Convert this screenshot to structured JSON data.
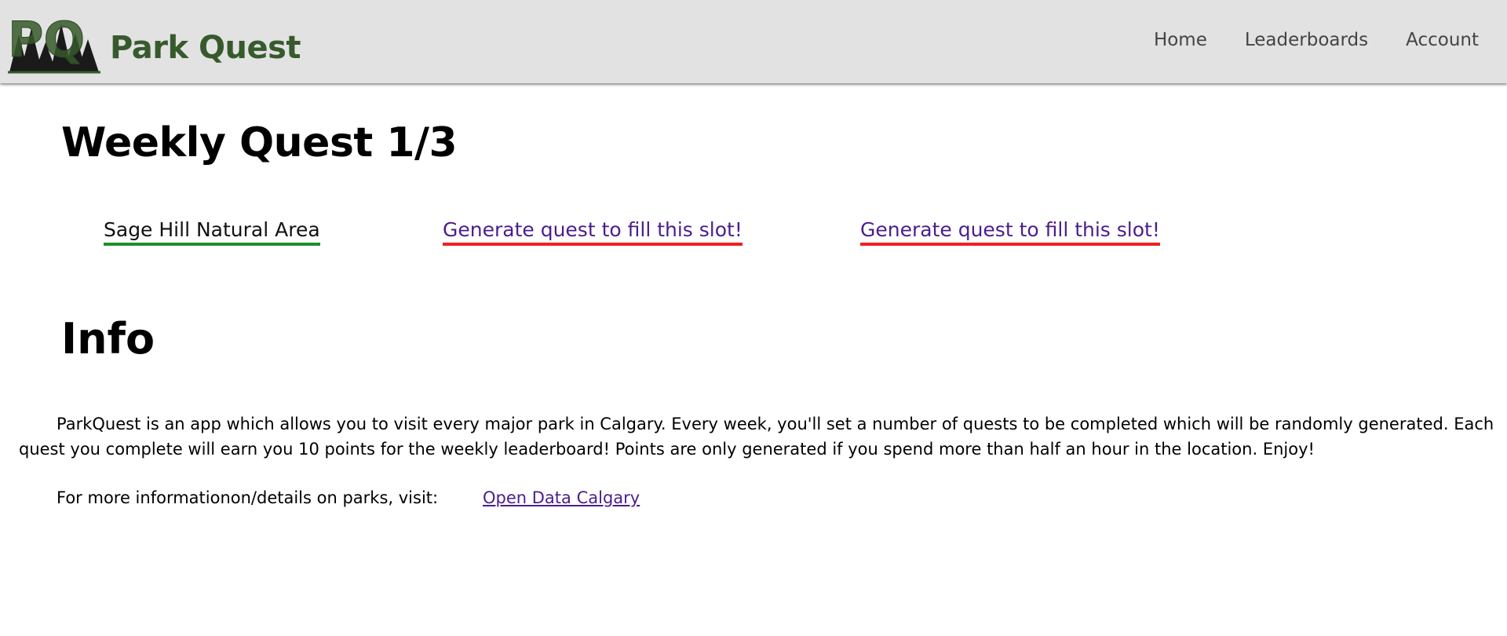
{
  "header": {
    "logo_text": "PQ",
    "brand_name": "Park Quest",
    "brand_color": "#375a2c",
    "nav": [
      {
        "label": "Home"
      },
      {
        "label": "Leaderboards"
      },
      {
        "label": "Account"
      }
    ]
  },
  "weekly": {
    "title": "Weekly Quest 1/3",
    "slots": [
      {
        "label": "Sage Hill Natural Area",
        "status": "active",
        "underline_color": "#1f8f2a"
      },
      {
        "label": "Generate quest to fill this slot!",
        "status": "empty",
        "underline_color": "#ee2222"
      },
      {
        "label": "Generate quest to fill this slot!",
        "status": "empty",
        "underline_color": "#ee2222"
      }
    ]
  },
  "info": {
    "title": "Info",
    "paragraph": "ParkQuest is an app which allows you to visit every major park in Calgary. Every week, you'll set a number of quests to be completed which will be randomly generated. Each quest you complete will earn you 10 points for the weekly leaderboard! Points are only generated if you spend more than half an hour in the location. Enjoy!",
    "more_info_label": "For more informationon/details on parks, visit:",
    "link_label": "Open Data Calgary"
  }
}
